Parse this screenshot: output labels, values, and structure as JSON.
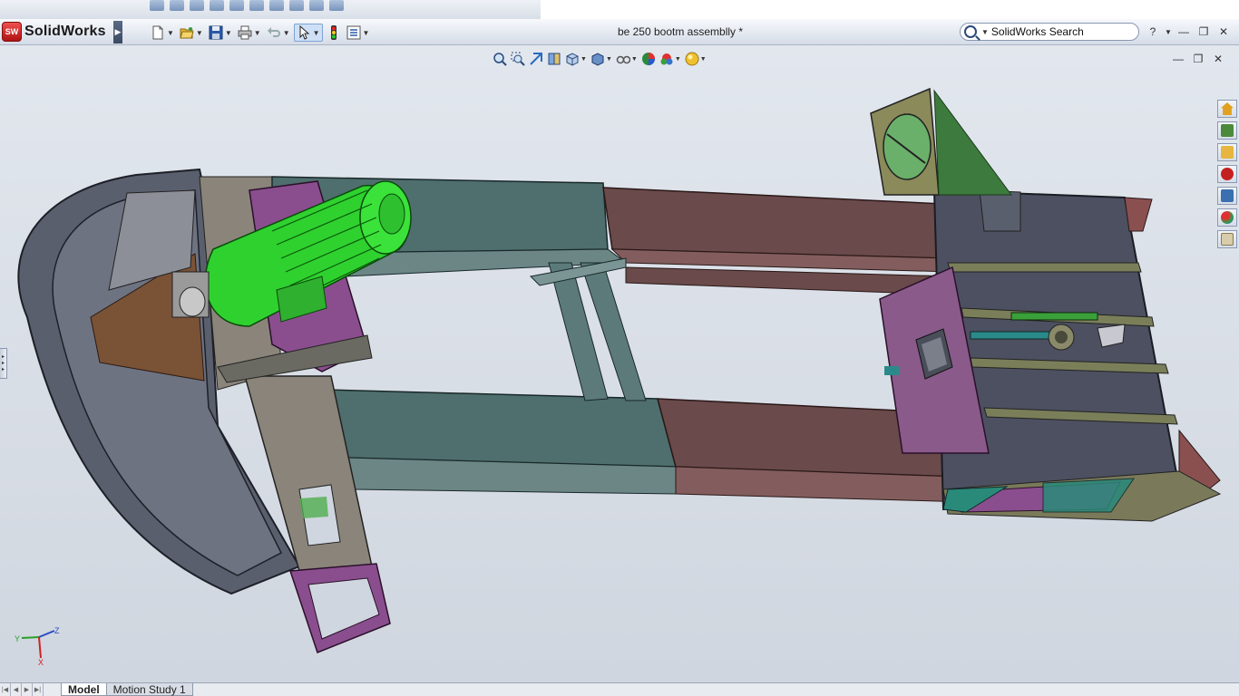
{
  "app": {
    "logo_badge": "SW",
    "logo_text": "SolidWorks",
    "document_title": "be 250 bootm assemblly *"
  },
  "search": {
    "value": "SolidWorks Search"
  },
  "standard_toolbar": [
    {
      "name": "new-document-button",
      "icon": "blank-page-icon"
    },
    {
      "name": "open-button",
      "icon": "folder-open-icon"
    },
    {
      "name": "save-button",
      "icon": "floppy-disk-icon"
    },
    {
      "name": "print-button",
      "icon": "printer-icon"
    },
    {
      "name": "undo-button",
      "icon": "undo-arrow-icon"
    },
    {
      "name": "select-button",
      "icon": "cursor-arrow-icon"
    },
    {
      "name": "rebuild-button",
      "icon": "traffic-light-icon"
    },
    {
      "name": "options-button",
      "icon": "list-options-icon"
    }
  ],
  "view_toolbar": [
    "zoom-to-fit-icon",
    "zoom-to-area-icon",
    "previous-view-icon",
    "section-view-icon",
    "view-orientation-icon",
    "display-style-icon",
    "hide-show-items-icon",
    "edit-appearance-icon",
    "apply-scene-icon",
    "view-settings-icon"
  ],
  "task_pane": [
    {
      "icon": "home-icon",
      "color": "#e0a020"
    },
    {
      "icon": "design-library-icon",
      "color": "#4b8a3a"
    },
    {
      "icon": "file-explorer-icon",
      "color": "#e6b640"
    },
    {
      "icon": "search-results-icon",
      "color": "#c42020"
    },
    {
      "icon": "view-palette-icon",
      "color": "#3a6fb0"
    },
    {
      "icon": "appearances-icon",
      "color": "#2f9e4a"
    },
    {
      "icon": "custom-properties-icon",
      "color": "#8a7a50"
    }
  ],
  "tabs": [
    {
      "label": "Model",
      "active": true
    },
    {
      "label": "Motion Study 1",
      "active": false
    }
  ],
  "triad": {
    "z": "Z",
    "y": "Y",
    "x": "X"
  },
  "colors": {
    "motor": "#2fd12f",
    "hopper": "#5a5f6e",
    "teal_channel": "#4f6e6e",
    "maroon_channel": "#6a4a4a",
    "purple_plate": "#8a4e8e",
    "olive_flange": "#8a8a5a"
  }
}
